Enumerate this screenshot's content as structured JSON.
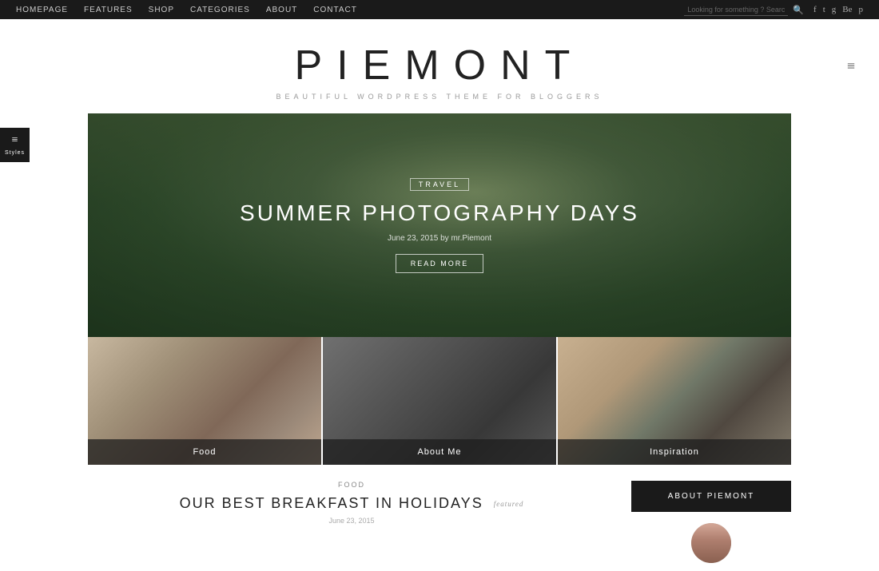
{
  "topnav": {
    "links": [
      {
        "id": "homepage",
        "label": "HOMEPAGE"
      },
      {
        "id": "features",
        "label": "FEATURES"
      },
      {
        "id": "shop",
        "label": "SHOP"
      },
      {
        "id": "categories",
        "label": "CATEGORIES"
      },
      {
        "id": "about",
        "label": "ABOUT"
      },
      {
        "id": "contact",
        "label": "CONTACT"
      }
    ],
    "search_placeholder": "Looking for something ? Search away?",
    "social": [
      "f",
      "t",
      "g+",
      "Be",
      "p"
    ]
  },
  "header": {
    "title": "PIEMONT",
    "tagline": "BEAUTIFUL  WORDPRESS THEME FOR BLOGGERS",
    "hamburger": "≡"
  },
  "hero": {
    "category": "TRAVEL",
    "title": "SUMMER PHOTOGRAPHY DAYS",
    "meta": "June 23, 2015 by mr.Piemont",
    "read_more": "READ MORE"
  },
  "thumbnails": [
    {
      "id": "food",
      "label": "Food"
    },
    {
      "id": "aboutme",
      "label": "About me"
    },
    {
      "id": "inspiration",
      "label": "Inspiration"
    }
  ],
  "blog_preview": {
    "category": "FOOD",
    "title": "OUR BEST BREAKFAST IN HOLIDAYS",
    "featured": "featured",
    "date": "June 23, 2015"
  },
  "sidebar": {
    "about_button": "ABOUT PIEMONT"
  },
  "styles_widget": {
    "label": "Styles"
  }
}
